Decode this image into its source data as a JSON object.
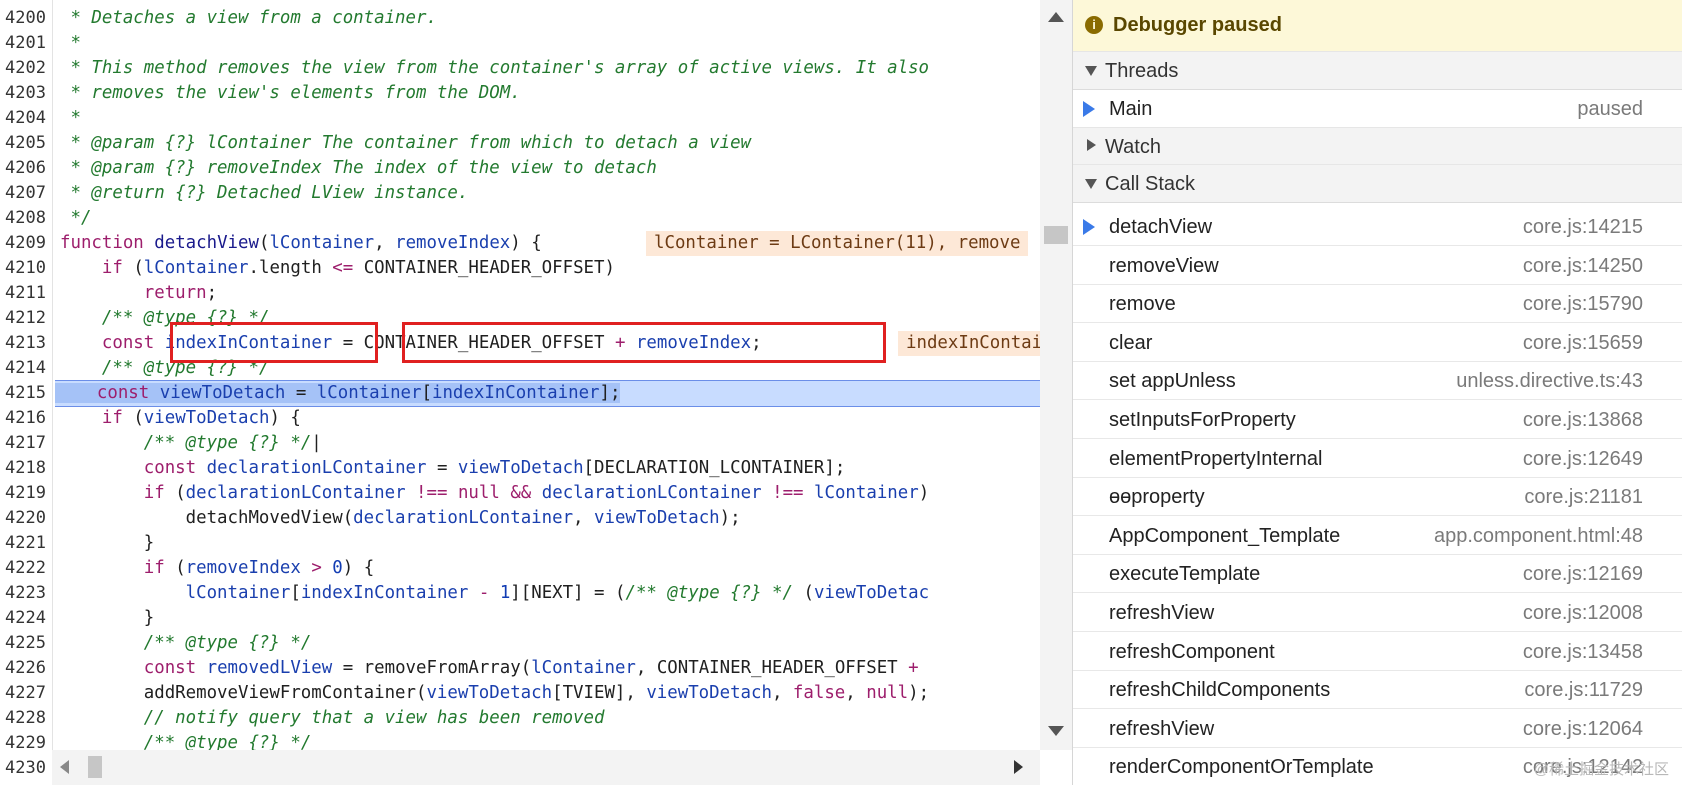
{
  "editor": {
    "lines": [
      {
        "n": "4200",
        "html": "<span class='t-c'> * Detaches a view from a container.</span>"
      },
      {
        "n": "4201",
        "html": "<span class='t-c'> *</span>"
      },
      {
        "n": "4202",
        "html": "<span class='t-c'> * This method removes the view from the container's array of active views. It also</span>"
      },
      {
        "n": "4203",
        "html": "<span class='t-c'> * removes the view's elements from the DOM.</span>"
      },
      {
        "n": "4204",
        "html": "<span class='t-c'> *</span>"
      },
      {
        "n": "4205",
        "html": "<span class='t-c'> * @param {?} lContainer The container from which to detach a view</span>"
      },
      {
        "n": "4206",
        "html": "<span class='t-c'> * @param {?} removeIndex The index of the view to detach</span>"
      },
      {
        "n": "4207",
        "html": "<span class='t-c'> * @return {?} Detached LView instance.</span>"
      },
      {
        "n": "4208",
        "html": "<span class='t-c'> */</span>"
      },
      {
        "n": "4209",
        "html": "<span class='t-k'>function</span> <span class='t-f'>detachView</span>(<span class='t-v'>lContainer</span>, <span class='t-v'>removeIndex</span>) {"
      },
      {
        "n": "4210",
        "html": "    <span class='t-k'>if</span> (<span class='t-v'>lContainer</span>.length <span class='t-k'>&lt;=</span> CONTAINER_HEADER_OFFSET)"
      },
      {
        "n": "4211",
        "html": "        <span class='t-k'>return</span>;"
      },
      {
        "n": "4212",
        "html": "    <span class='t-c'>/** @type {?} */</span>"
      },
      {
        "n": "4213",
        "html": "    <span class='t-k'>const</span> <span class='t-v'>indexInContainer</span> = CONTAINER_HEADER_OFFSET <span class='t-k'>+</span> <span class='t-v'>removeIndex</span>;"
      },
      {
        "n": "4214",
        "html": "    <span class='t-c'>/** @type {?} */</span>"
      },
      {
        "n": "4215",
        "html": "<span class='hl'>    <span class='t-k'>const</span> <span class='t-v'>viewToDetach</span> = <span class='t-v'>lContainer</span>[<span class='t-v'>indexInContainer</span>];</span>",
        "exec": true
      },
      {
        "n": "4216",
        "html": "    <span class='t-k'>if</span> (<span class='t-v'>viewToDetach</span>) {"
      },
      {
        "n": "4217",
        "html": "        <span class='t-c'>/** @type {?} */</span>|"
      },
      {
        "n": "4218",
        "html": "        <span class='t-k'>const</span> <span class='t-v'>declarationLContainer</span> = <span class='t-v'>viewToDetach</span>[DECLARATION_LCONTAINER];"
      },
      {
        "n": "4219",
        "html": "        <span class='t-k'>if</span> (<span class='t-v'>declarationLContainer</span> <span class='t-k'>!==</span> <span class='t-k'>null</span> <span class='t-k'>&amp;&amp;</span> <span class='t-v'>declarationLContainer</span> <span class='t-k'>!==</span> <span class='t-v'>lContainer</span>)"
      },
      {
        "n": "4220",
        "html": "            detachMovedView(<span class='t-v'>declarationLContainer</span>, <span class='t-v'>viewToDetach</span>);"
      },
      {
        "n": "4221",
        "html": "        }"
      },
      {
        "n": "4222",
        "html": "        <span class='t-k'>if</span> (<span class='t-v'>removeIndex</span> <span class='t-k'>&gt;</span> <span class='t-n'>0</span>) {"
      },
      {
        "n": "4223",
        "html": "            <span class='t-v'>lContainer</span>[<span class='t-v'>indexInContainer</span> <span class='t-k'>-</span> <span class='t-n'>1</span>][NEXT] = (<span class='t-c'>/** @type {?} */</span> (<span class='t-v'>viewToDetac</span>"
      },
      {
        "n": "4224",
        "html": "        }"
      },
      {
        "n": "4225",
        "html": "        <span class='t-c'>/** @type {?} */</span>"
      },
      {
        "n": "4226",
        "html": "        <span class='t-k'>const</span> <span class='t-v'>removedLView</span> = removeFromArray(<span class='t-v'>lContainer</span>, CONTAINER_HEADER_OFFSET <span class='t-k'>+</span>"
      },
      {
        "n": "4227",
        "html": "        addRemoveViewFromContainer(<span class='t-v'>viewToDetach</span>[TVIEW], <span class='t-v'>viewToDetach</span>, <span class='t-k'>false</span>, <span class='t-k'>null</span>);"
      },
      {
        "n": "4228",
        "html": "        <span class='t-c'>// notify query that a view has been removed</span>"
      },
      {
        "n": "4229",
        "html": "        <span class='t-c'>/** @type {?} */</span>"
      },
      {
        "n": "4230",
        "html": ""
      }
    ],
    "inline_values": [
      {
        "text": "lContainer = LContainer(11), remove",
        "line": 9
      },
      {
        "text": "indexInContain",
        "line": 13
      }
    ]
  },
  "panel": {
    "paused_label": "Debugger paused",
    "sections": {
      "threads": "Threads",
      "watch": "Watch",
      "call_stack": "Call Stack"
    },
    "thread": {
      "name": "Main",
      "status": "paused"
    },
    "call_stack": [
      {
        "name": "detachView",
        "loc": "core.js:14215",
        "current": true
      },
      {
        "name": "removeView",
        "loc": "core.js:14250"
      },
      {
        "name": "remove",
        "loc": "core.js:15790"
      },
      {
        "name": "clear",
        "loc": "core.js:15659"
      },
      {
        "name": "set appUnless",
        "loc": "unless.directive.ts:43"
      },
      {
        "name": "setInputsForProperty",
        "loc": "core.js:13868"
      },
      {
        "name": "elementPropertyInternal",
        "loc": "core.js:12649"
      },
      {
        "name": "ɵɵproperty",
        "loc": "core.js:21181"
      },
      {
        "name": "AppComponent_Template",
        "loc": "app.component.html:48"
      },
      {
        "name": "executeTemplate",
        "loc": "core.js:12169"
      },
      {
        "name": "refreshView",
        "loc": "core.js:12008"
      },
      {
        "name": "refreshComponent",
        "loc": "core.js:13458"
      },
      {
        "name": "refreshChildComponents",
        "loc": "core.js:11729"
      },
      {
        "name": "refreshView",
        "loc": "core.js:12064"
      },
      {
        "name": "renderComponentOrTemplate",
        "loc": "core.js:12142"
      }
    ],
    "watermark": "@稀土掘金技术社区"
  }
}
